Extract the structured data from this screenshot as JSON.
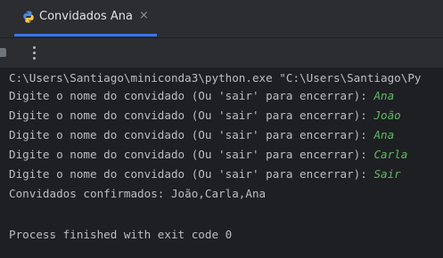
{
  "tab": {
    "title": "Convidados Ana",
    "icon": "python-icon",
    "close_glyph": "×"
  },
  "toolbar": {
    "stop_icon": "stop-icon",
    "menu_icon": "more-vertical-icon"
  },
  "console": {
    "command_line": "C:\\Users\\Santiago\\miniconda3\\python.exe \"C:\\Users\\Santiago\\Py",
    "prompts": [
      {
        "prompt": "Digite o nome do convidado (Ou 'sair' para encerrar): ",
        "input": "Ana"
      },
      {
        "prompt": "Digite o nome do convidado (Ou 'sair' para encerrar): ",
        "input": "João"
      },
      {
        "prompt": "Digite o nome do convidado (Ou 'sair' para encerrar): ",
        "input": "Ana"
      },
      {
        "prompt": "Digite o nome do convidado (Ou 'sair' para encerrar): ",
        "input": "Carla"
      },
      {
        "prompt": "Digite o nome do convidado (Ou 'sair' para encerrar): ",
        "input": "Sair"
      }
    ],
    "result_line": "Convidados confirmados: João,Carla,Ana",
    "exit_line": "Process finished with exit code 0"
  },
  "colors": {
    "background": "#1e1f22",
    "panel": "#2b2d30",
    "text": "#bcbec4",
    "user_input": "#5fb865",
    "accent": "#3574f0"
  }
}
